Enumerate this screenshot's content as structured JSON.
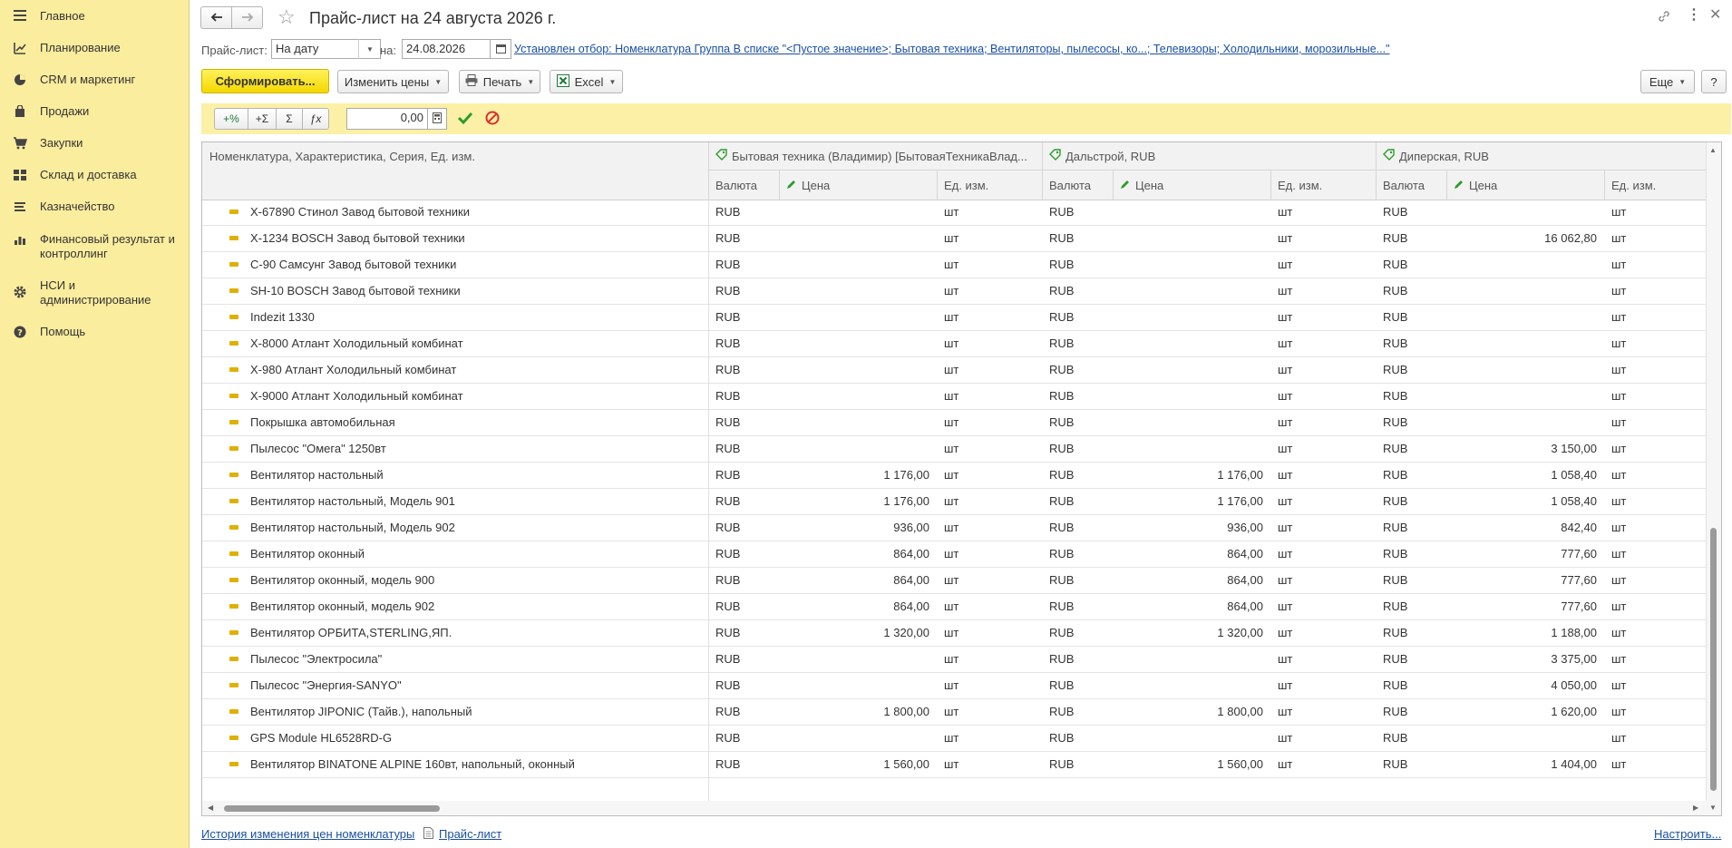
{
  "sidebar": {
    "items": [
      {
        "label": "Главное",
        "icon": "menu-icon"
      },
      {
        "label": "Планирование",
        "icon": "planning-icon"
      },
      {
        "label": "CRM и маркетинг",
        "icon": "pie-chart-icon"
      },
      {
        "label": "Продажи",
        "icon": "shopping-bag-icon"
      },
      {
        "label": "Закупки",
        "icon": "cart-icon"
      },
      {
        "label": "Склад и доставка",
        "icon": "warehouse-icon"
      },
      {
        "label": "Казначейство",
        "icon": "treasury-icon"
      },
      {
        "label": "Финансовый результат и контроллинг",
        "icon": "bar-chart-icon"
      },
      {
        "label": "НСИ и администрирование",
        "icon": "gear-icon"
      },
      {
        "label": "Помощь",
        "icon": "help-icon"
      }
    ]
  },
  "header": {
    "title": "Прайс-лист на 24 августа 2026 г."
  },
  "filter": {
    "pricelist_label": "Прайс-лист:",
    "pricelist_value": "На дату",
    "date_label": "на:",
    "date_value": "24.08.2026",
    "selection_link": "Установлен отбор: Номенклатура Группа В списке \"<Пустое значение>; Бытовая техника; Вентиляторы, пылесосы, ко...; Телевизоры; Холодильники, морозильные...\""
  },
  "toolbar": {
    "generate": "Сформировать...",
    "change_prices": "Изменить цены",
    "print": "Печать",
    "excel": "Excel",
    "more": "Еще",
    "help": "?"
  },
  "edit_bar": {
    "percent": "+%",
    "plus_sum": "+Σ",
    "sigma": "Σ",
    "fx": "ƒx",
    "value": "0,00"
  },
  "table": {
    "col_name": "Номенклатура, Характеристика, Серия, Ед. изм.",
    "groups": [
      "Бытовая техника (Владимир) [БытоваяТехникаВлад...",
      "Дальстрой, RUB",
      "Диперская, RUB"
    ],
    "sub_currency": "Валюта",
    "sub_price": "Цена",
    "sub_unit": "Ед. изм.",
    "rows": [
      {
        "name": "X-67890 Стинол Завод бытовой техники",
        "c1": "RUB",
        "p1": "",
        "u1": "шт",
        "c2": "RUB",
        "p2": "",
        "u2": "шт",
        "c3": "RUB",
        "p3": "",
        "u3": "шт"
      },
      {
        "name": "X-1234 BOSCH Завод бытовой техники",
        "c1": "RUB",
        "p1": "",
        "u1": "шт",
        "c2": "RUB",
        "p2": "",
        "u2": "шт",
        "c3": "RUB",
        "p3": "16 062,80",
        "u3": "шт"
      },
      {
        "name": "C-90 Самсунг Завод бытовой техники",
        "c1": "RUB",
        "p1": "",
        "u1": "шт",
        "c2": "RUB",
        "p2": "",
        "u2": "шт",
        "c3": "RUB",
        "p3": "",
        "u3": "шт"
      },
      {
        "name": "SH-10 BOSCH Завод бытовой техники",
        "c1": "RUB",
        "p1": "",
        "u1": "шт",
        "c2": "RUB",
        "p2": "",
        "u2": "шт",
        "c3": "RUB",
        "p3": "",
        "u3": "шт"
      },
      {
        "name": "Indezit 1330",
        "c1": "RUB",
        "p1": "",
        "u1": "шт",
        "c2": "RUB",
        "p2": "",
        "u2": "шт",
        "c3": "RUB",
        "p3": "",
        "u3": "шт"
      },
      {
        "name": "X-8000 Атлант Холодильный комбинат",
        "c1": "RUB",
        "p1": "",
        "u1": "шт",
        "c2": "RUB",
        "p2": "",
        "u2": "шт",
        "c3": "RUB",
        "p3": "",
        "u3": "шт"
      },
      {
        "name": "X-980 Атлант Холодильный комбинат",
        "c1": "RUB",
        "p1": "",
        "u1": "шт",
        "c2": "RUB",
        "p2": "",
        "u2": "шт",
        "c3": "RUB",
        "p3": "",
        "u3": "шт"
      },
      {
        "name": "X-9000 Атлант Холодильный комбинат",
        "c1": "RUB",
        "p1": "",
        "u1": "шт",
        "c2": "RUB",
        "p2": "",
        "u2": "шт",
        "c3": "RUB",
        "p3": "",
        "u3": "шт"
      },
      {
        "name": "Покрышка автомобильная",
        "c1": "RUB",
        "p1": "",
        "u1": "шт",
        "c2": "RUB",
        "p2": "",
        "u2": "шт",
        "c3": "RUB",
        "p3": "",
        "u3": "шт"
      },
      {
        "name": "Пылесос \"Омега\" 1250вт",
        "c1": "RUB",
        "p1": "",
        "u1": "шт",
        "c2": "RUB",
        "p2": "",
        "u2": "шт",
        "c3": "RUB",
        "p3": "3 150,00",
        "u3": "шт"
      },
      {
        "name": "Вентилятор настольный",
        "c1": "RUB",
        "p1": "1 176,00",
        "u1": "шт",
        "c2": "RUB",
        "p2": "1 176,00",
        "u2": "шт",
        "c3": "RUB",
        "p3": "1 058,40",
        "u3": "шт"
      },
      {
        "name": "Вентилятор настольный, Модель 901",
        "c1": "RUB",
        "p1": "1 176,00",
        "u1": "шт",
        "c2": "RUB",
        "p2": "1 176,00",
        "u2": "шт",
        "c3": "RUB",
        "p3": "1 058,40",
        "u3": "шт"
      },
      {
        "name": "Вентилятор настольный, Модель 902",
        "c1": "RUB",
        "p1": "936,00",
        "u1": "шт",
        "c2": "RUB",
        "p2": "936,00",
        "u2": "шт",
        "c3": "RUB",
        "p3": "842,40",
        "u3": "шт"
      },
      {
        "name": "Вентилятор оконный",
        "c1": "RUB",
        "p1": "864,00",
        "u1": "шт",
        "c2": "RUB",
        "p2": "864,00",
        "u2": "шт",
        "c3": "RUB",
        "p3": "777,60",
        "u3": "шт"
      },
      {
        "name": "Вентилятор оконный, модель 900",
        "c1": "RUB",
        "p1": "864,00",
        "u1": "шт",
        "c2": "RUB",
        "p2": "864,00",
        "u2": "шт",
        "c3": "RUB",
        "p3": "777,60",
        "u3": "шт"
      },
      {
        "name": "Вентилятор оконный, модель 902",
        "c1": "RUB",
        "p1": "864,00",
        "u1": "шт",
        "c2": "RUB",
        "p2": "864,00",
        "u2": "шт",
        "c3": "RUB",
        "p3": "777,60",
        "u3": "шт"
      },
      {
        "name": "Вентилятор ОРБИТА,STERLING,ЯП.",
        "c1": "RUB",
        "p1": "1 320,00",
        "u1": "шт",
        "c2": "RUB",
        "p2": "1 320,00",
        "u2": "шт",
        "c3": "RUB",
        "p3": "1 188,00",
        "u3": "шт"
      },
      {
        "name": "Пылесос \"Электросила\"",
        "c1": "RUB",
        "p1": "",
        "u1": "шт",
        "c2": "RUB",
        "p2": "",
        "u2": "шт",
        "c3": "RUB",
        "p3": "3 375,00",
        "u3": "шт"
      },
      {
        "name": "Пылесос \"Энергия-SANYO\"",
        "c1": "RUB",
        "p1": "",
        "u1": "шт",
        "c2": "RUB",
        "p2": "",
        "u2": "шт",
        "c3": "RUB",
        "p3": "4 050,00",
        "u3": "шт"
      },
      {
        "name": "Вентилятор JIPONIC (Тайв.), напольный",
        "c1": "RUB",
        "p1": "1 800,00",
        "u1": "шт",
        "c2": "RUB",
        "p2": "1 800,00",
        "u2": "шт",
        "c3": "RUB",
        "p3": "1 620,00",
        "u3": "шт"
      },
      {
        "name": "GPS Module HL6528RD-G",
        "c1": "RUB",
        "p1": "",
        "u1": "шт",
        "c2": "RUB",
        "p2": "",
        "u2": "шт",
        "c3": "RUB",
        "p3": "",
        "u3": "шт"
      },
      {
        "name": "Вентилятор BINATONE ALPINE 160вт, напольный, оконный",
        "c1": "RUB",
        "p1": "1 560,00",
        "u1": "шт",
        "c2": "RUB",
        "p2": "1 560,00",
        "u2": "шт",
        "c3": "RUB",
        "p3": "1 404,00",
        "u3": "шт"
      }
    ]
  },
  "footer": {
    "history_link": "История изменения цен номенклатуры",
    "pricelist_link": "Прайс-лист",
    "settings_link": "Настроить..."
  },
  "colors": {
    "sidebar_bg": "#fbed9e",
    "accent_yellow": "#f5d700",
    "edit_bar_bg": "#fbf0a6",
    "link": "#1a4fa3"
  }
}
